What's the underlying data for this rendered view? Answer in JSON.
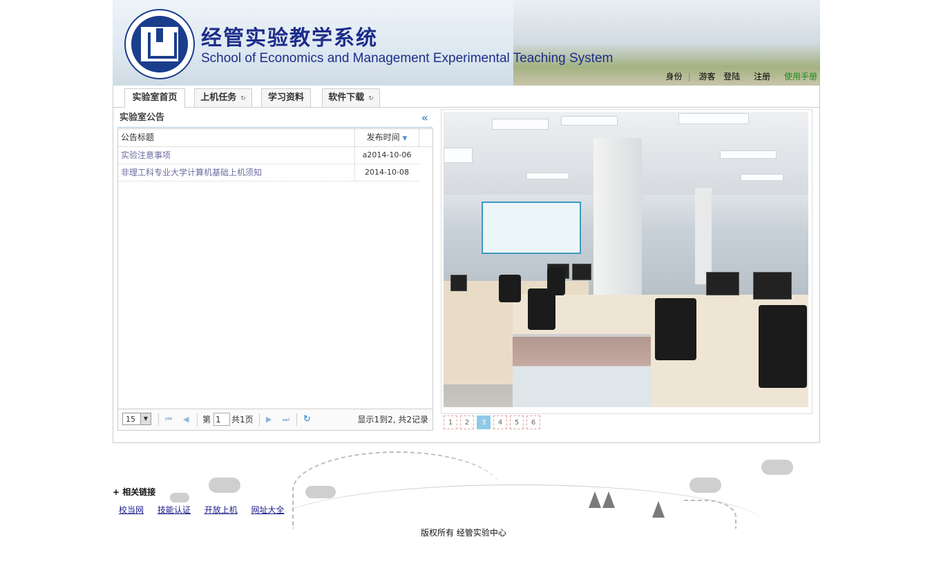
{
  "header": {
    "title_cn": "经管实验教学系统",
    "title_en": "School of Economics and Management Experimental Teaching System",
    "links": [
      "身份",
      "游客",
      "登陆",
      "注册",
      "使用手册"
    ]
  },
  "tabs": [
    {
      "label": "实验室首页",
      "active": true
    },
    {
      "label": "上机任务",
      "active": false
    },
    {
      "label": "学习资料",
      "active": false
    },
    {
      "label": "软件下载",
      "active": false
    }
  ],
  "notice_panel": {
    "title": "实验室公告",
    "columns": [
      "公告标题",
      "发布时间"
    ],
    "rows": [
      {
        "title": "实验注意事项",
        "date": "a2014-10-06"
      },
      {
        "title": "非理工科专业大学计算机基础上机须知",
        "date": "2014-10-08"
      }
    ]
  },
  "pager": {
    "page_size": "15",
    "page_prefix": "第",
    "page_value": "1",
    "page_suffix": "共1页",
    "info": "显示1到2, 共2记录"
  },
  "slideshow": {
    "pages": [
      "1",
      "2",
      "3",
      "4",
      "5",
      "6"
    ],
    "active_page": "3"
  },
  "footer": {
    "links_title": "+ 相关链接",
    "links": [
      "校当网",
      "技能认证",
      "开放上机",
      "网址大全"
    ],
    "copyright": "版权所有   经管实验中心"
  },
  "colors": {
    "brand": "#1d2d8a",
    "manual_link": "#1a8a1a",
    "slide_active": "#8fc9e8"
  }
}
